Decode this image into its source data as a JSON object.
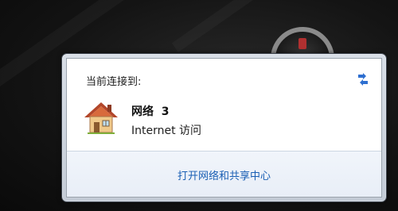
{
  "flyout": {
    "heading": "当前连接到:",
    "network": {
      "name": "网络  3",
      "access": "Internet 访问",
      "icon": "home-network-icon"
    },
    "refresh_icon": "refresh-arrows-icon",
    "footer_link": "打开网络和共享中心"
  },
  "colors": {
    "link": "#1a5fb4",
    "footer_bg": "#eef3fa",
    "refresh_icon": "#2e6fd0"
  }
}
